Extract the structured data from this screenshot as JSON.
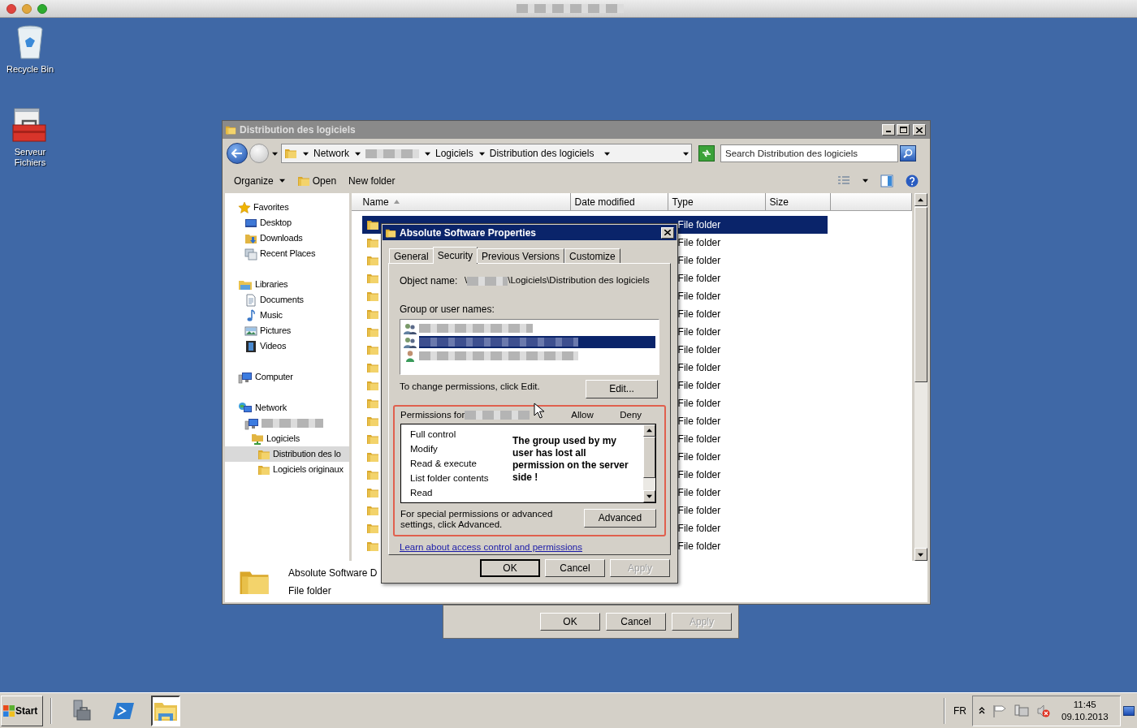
{
  "desktop_icons": [
    {
      "kind": "recycle-bin",
      "label": "Recycle Bin"
    },
    {
      "kind": "toolbox",
      "label": "Serveur Fichiers"
    }
  ],
  "explorer": {
    "title": "Distribution des logiciels",
    "breadcrumb": [
      {
        "kind": "text",
        "label": "Network"
      },
      {
        "kind": "redacted"
      },
      {
        "kind": "text",
        "label": "Logiciels"
      },
      {
        "kind": "text",
        "label": "Distribution des logiciels"
      }
    ],
    "search": {
      "placeholder": "Search Distribution des logiciels"
    },
    "toolbar": [
      {
        "kind": "menu",
        "label": "Organize"
      },
      {
        "kind": "icon",
        "label": "Open"
      },
      {
        "kind": "plain",
        "label": "New folder"
      }
    ],
    "nav": [
      {
        "label": "Favorites",
        "kind": "star",
        "selected": false,
        "children": [
          {
            "label": "Desktop",
            "kind": "desktop",
            "selected": false
          },
          {
            "label": "Downloads",
            "kind": "downloads",
            "selected": false
          },
          {
            "label": "Recent Places",
            "kind": "recent",
            "selected": false
          }
        ]
      },
      {
        "label": "Libraries",
        "kind": "library",
        "selected": false,
        "children": [
          {
            "label": "Documents",
            "kind": "document",
            "selected": false
          },
          {
            "label": "Music",
            "kind": "music",
            "selected": false
          },
          {
            "label": "Pictures",
            "kind": "pictures",
            "selected": false
          },
          {
            "label": "Videos",
            "kind": "videos",
            "selected": false
          }
        ]
      },
      {
        "label": "Computer",
        "kind": "computer",
        "selected": false
      },
      {
        "label": "Network",
        "kind": "network",
        "selected": false,
        "children": [
          {
            "kind": "computer",
            "selected": false,
            "children": [
              {
                "label": "Logiciels",
                "kind": "share",
                "selected": false,
                "children": [
                  {
                    "label": "Distribution des lo",
                    "kind": "folder",
                    "selected": true
                  },
                  {
                    "label": "Logiciels originaux",
                    "kind": "folder",
                    "selected": false
                  }
                ]
              }
            ]
          }
        ]
      }
    ],
    "columns": [
      {
        "label": "Name",
        "sorted": true
      },
      {
        "label": "Date modified",
        "sorted": false
      },
      {
        "label": "Type",
        "sorted": false
      },
      {
        "label": "Size",
        "sorted": false
      }
    ],
    "rows": [
      {
        "type": "File folder",
        "selected": true
      },
      {
        "type": "File folder",
        "selected": false
      },
      {
        "type": "File folder",
        "selected": false
      },
      {
        "type": "File folder",
        "selected": false
      },
      {
        "type": "File folder",
        "selected": false
      },
      {
        "type": "File folder",
        "selected": false
      },
      {
        "type": "File folder",
        "selected": false
      },
      {
        "type": "File folder",
        "selected": false
      },
      {
        "type": "File folder",
        "selected": false
      },
      {
        "type": "File folder",
        "selected": false
      },
      {
        "type": "File folder",
        "selected": false
      },
      {
        "type": "File folder",
        "selected": false
      },
      {
        "type": "File folder",
        "selected": false
      },
      {
        "type": "File folder",
        "selected": false
      },
      {
        "type": "File folder",
        "selected": false
      },
      {
        "type": "File folder",
        "selected": false
      },
      {
        "type": "File folder",
        "selected": false
      },
      {
        "type": "File folder",
        "selected": false
      },
      {
        "type": "File folder",
        "selected": false
      }
    ],
    "details": {
      "name": "Absolute Software D",
      "type": "File folder"
    }
  },
  "dialog": {
    "title": "Absolute Software Properties",
    "tabs": [
      {
        "label": "General",
        "selected": false
      },
      {
        "label": "Security",
        "selected": true
      },
      {
        "label": "Previous Versions",
        "selected": false
      },
      {
        "label": "Customize",
        "selected": false
      }
    ],
    "object_name": {
      "label": "Object name:",
      "prefix": "\\",
      "suffix": "\\Logiciels\\Distribution des logiciels"
    },
    "groups_label": "Group or user names:",
    "groups": [
      {
        "kind": "group",
        "selected": false
      },
      {
        "kind": "group",
        "selected": true
      },
      {
        "kind": "user",
        "selected": false
      }
    ],
    "edit_hint": "To change permissions, click Edit.",
    "edit_button": "Edit...",
    "permissions": {
      "label": "Permissions for",
      "columns": [
        "Allow",
        "Deny"
      ],
      "highlighted": true,
      "items": [
        "Full control",
        "Modify",
        "Read & execute",
        "List folder contents",
        "Read"
      ]
    },
    "annotation": "The group used by my user has lost all permission on the server side !",
    "advanced_hint": "For special permissions or advanced settings, click Advanced.",
    "advanced_button": "Advanced",
    "link": "Learn about access control and permissions",
    "buttons": [
      {
        "label": "OK",
        "kind": "default"
      },
      {
        "label": "Cancel",
        "kind": "normal"
      },
      {
        "label": "Apply",
        "kind": "disabled"
      }
    ]
  },
  "back_dialog": {
    "buttons": [
      {
        "label": "OK",
        "kind": "normal"
      },
      {
        "label": "Cancel",
        "kind": "normal"
      },
      {
        "label": "Apply",
        "kind": "disabled"
      }
    ]
  },
  "taskbar": {
    "start": "Start",
    "apps": [
      {
        "kind": "server-manager",
        "active": false
      },
      {
        "kind": "powershell",
        "active": false
      },
      {
        "kind": "explorer",
        "active": true
      }
    ],
    "language": "FR",
    "time": "11:45",
    "date": "09.10.2013"
  }
}
